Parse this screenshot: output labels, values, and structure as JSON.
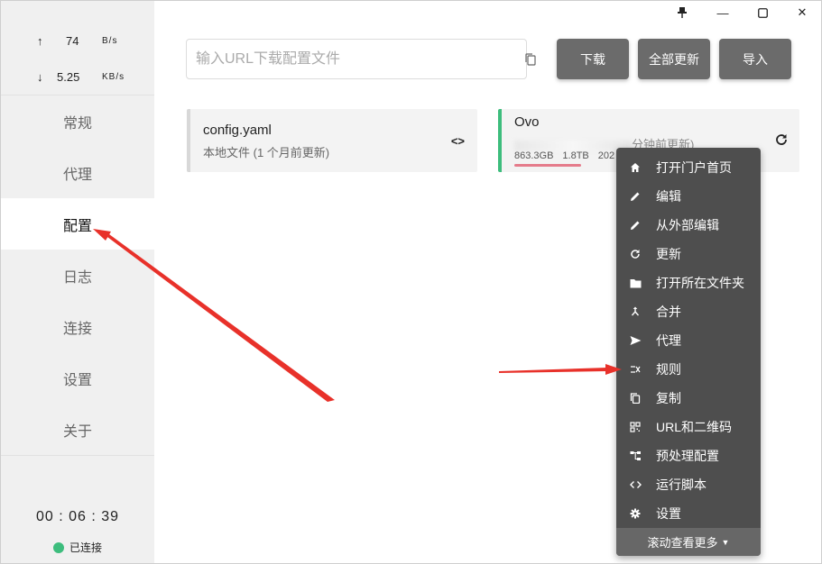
{
  "titlebar": {
    "pin_icon": "pin-icon",
    "min_glyph": "—",
    "max_glyph": "☐",
    "close_glyph": "✕"
  },
  "traffic": {
    "up_arrow": "↑",
    "up_value": "74",
    "up_unit": "B/s",
    "down_arrow": "↓",
    "down_value": "5.25",
    "down_unit": "KB/s"
  },
  "nav": {
    "items": [
      "常规",
      "代理",
      "配置",
      "日志",
      "连接",
      "设置",
      "关于"
    ],
    "active": "配置"
  },
  "timer": "00 : 06 : 39",
  "connection_status": "已连接",
  "toolbar": {
    "url_placeholder": "输入URL下载配置文件",
    "download_label": "下载",
    "update_all_label": "全部更新",
    "import_label": "导入"
  },
  "profiles": [
    {
      "name": "config.yaml",
      "subtitle": "本地文件 (1 个月前更新)",
      "icon": "code-icon"
    },
    {
      "name": "Ovo",
      "subtitle_visible": "分钟前更新)",
      "used": "863.3GB",
      "total": "1.8TB",
      "expire_partial": "202",
      "usage_fraction": 0.47,
      "accent": "#3dbd7d",
      "icon": "refresh-icon"
    }
  ],
  "context_menu": {
    "items": [
      {
        "label": "打开门户首页",
        "icon": "home-icon"
      },
      {
        "label": "编辑",
        "icon": "pencil-icon"
      },
      {
        "label": "从外部编辑",
        "icon": "pencil-icon"
      },
      {
        "label": "更新",
        "icon": "refresh-icon"
      },
      {
        "label": "打开所在文件夹",
        "icon": "folder-icon"
      },
      {
        "label": "合并",
        "icon": "merge-icon"
      },
      {
        "label": "代理",
        "icon": "send-icon"
      },
      {
        "label": "规则",
        "icon": "shuffle-icon"
      },
      {
        "label": "复制",
        "icon": "copy-icon"
      },
      {
        "label": "URL和二维码",
        "icon": "qrcode-icon"
      },
      {
        "label": "预处理配置",
        "icon": "tree-icon"
      },
      {
        "label": "运行脚本",
        "icon": "code-icon"
      },
      {
        "label": "设置",
        "icon": "gear-icon"
      }
    ],
    "more_label": "滚动查看更多"
  },
  "colors": {
    "accent_green": "#3dbd7d",
    "button_gray": "#6b6b6b",
    "menu_bg": "#4e4e4e",
    "annotation_red": "#e8312a",
    "usage_bar": "#e57b8b"
  }
}
